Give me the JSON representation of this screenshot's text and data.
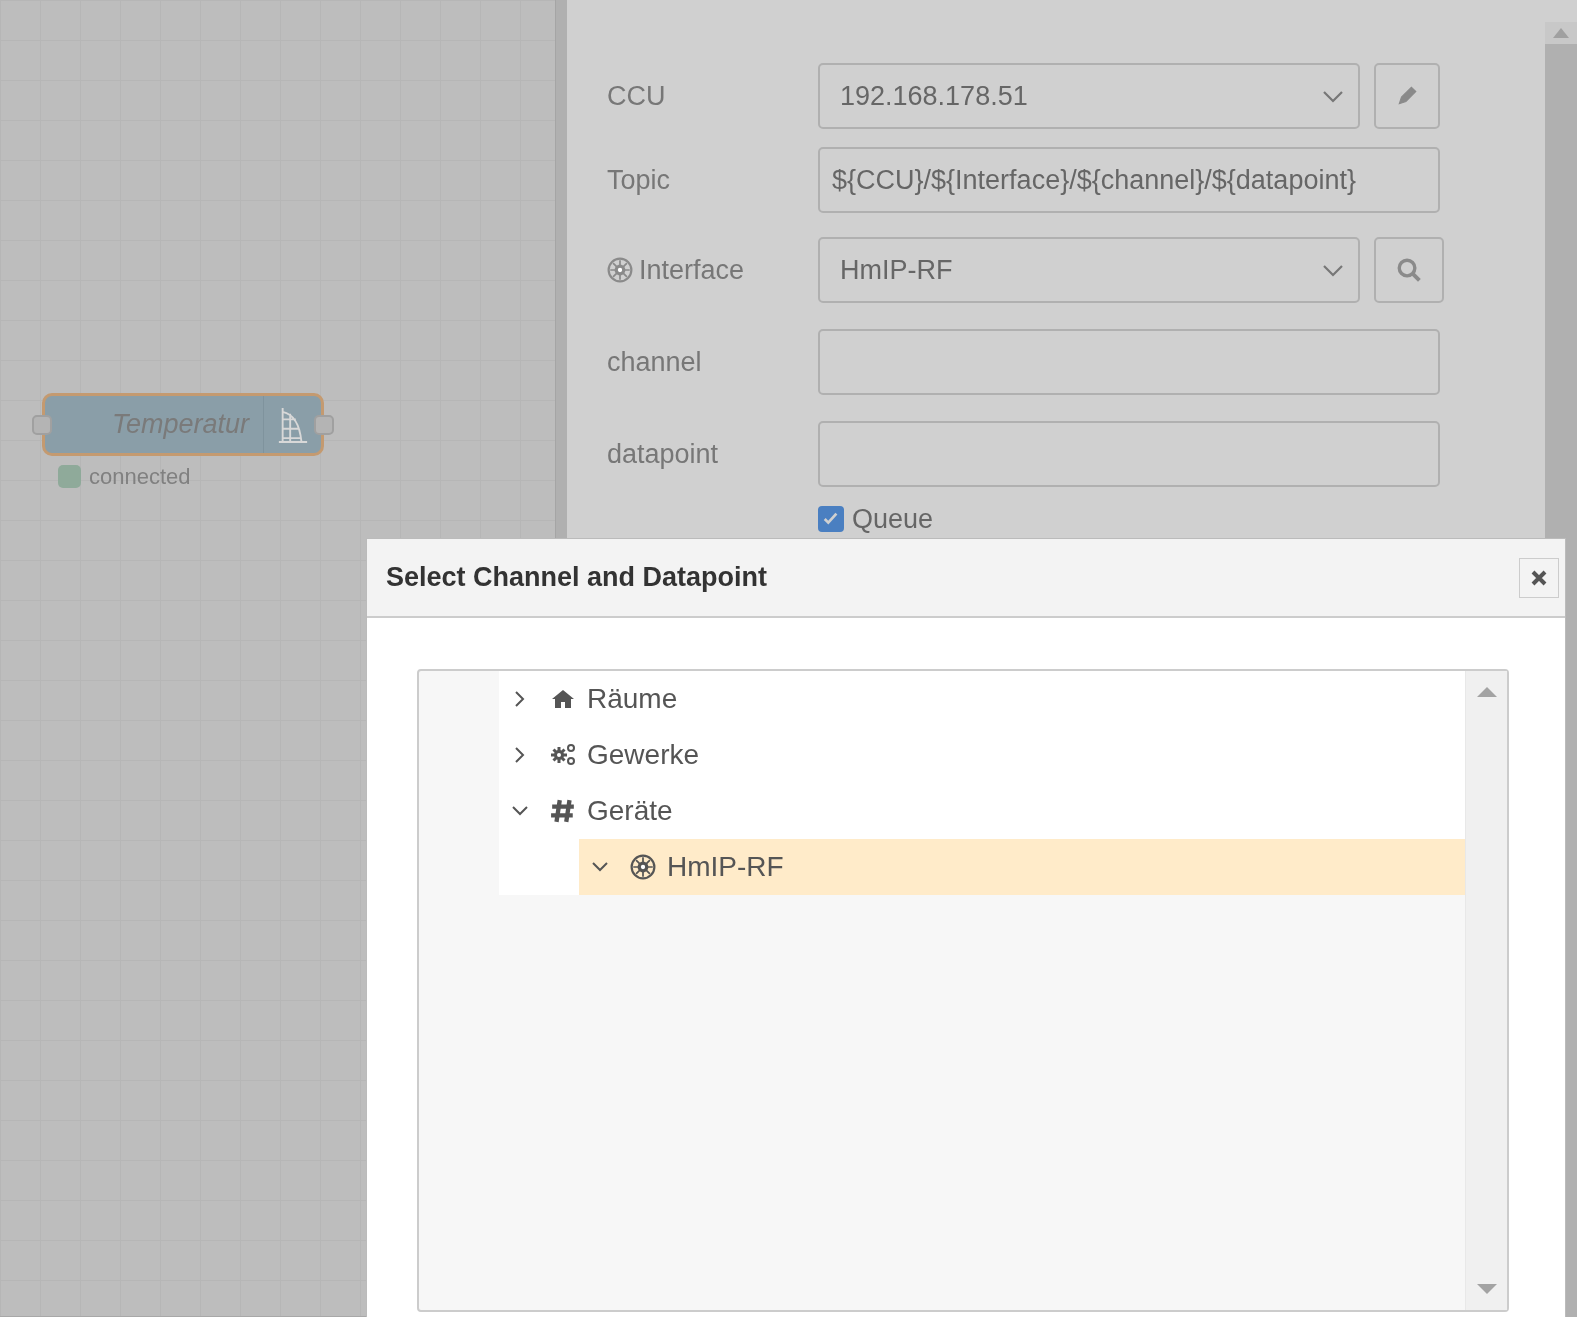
{
  "canvas": {
    "node": {
      "label": "Temperatur",
      "status": {
        "text": "connected",
        "color": "#8faa9a"
      }
    }
  },
  "editor": {
    "fields": [
      {
        "kind": "select",
        "label": "CCU",
        "value": "192.168.178.51",
        "button": {
          "kind": "edit"
        }
      },
      {
        "kind": "text",
        "label": "Topic",
        "value": "${CCU}/${Interface}/${channel}/${datapoint}"
      },
      {
        "kind": "select",
        "label": "Interface",
        "icon": {
          "kind": "interface"
        },
        "value": "HmIP-RF",
        "button": {
          "kind": "search"
        }
      },
      {
        "kind": "text",
        "label": "channel"
      },
      {
        "kind": "text",
        "label": "datapoint"
      }
    ],
    "queue": {
      "label": "Queue",
      "checked": true
    }
  },
  "dialog": {
    "title": "Select Channel and Datapoint",
    "tree": [
      {
        "kind": "rooms",
        "label": "Räume",
        "expanded": false,
        "selected": false
      },
      {
        "kind": "trades",
        "label": "Gewerke",
        "expanded": false,
        "selected": false
      },
      {
        "kind": "devices",
        "label": "Geräte",
        "expanded": true,
        "selected": false,
        "children": [
          {
            "kind": "interface",
            "label": "HmIP-RF",
            "expanded": true,
            "selected": true
          }
        ]
      }
    ]
  }
}
